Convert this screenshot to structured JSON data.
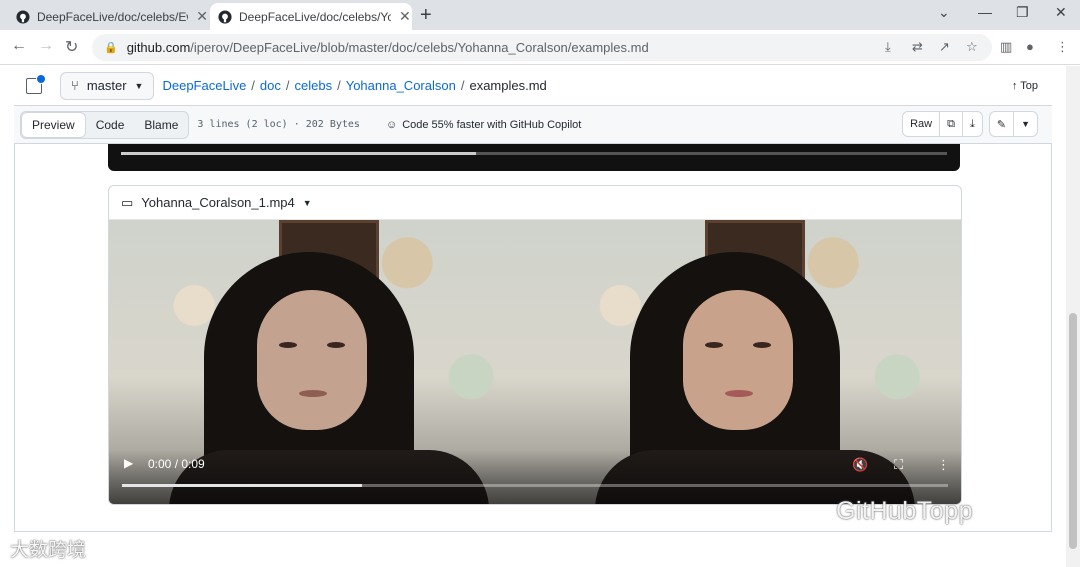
{
  "browser": {
    "tabs": [
      {
        "title": "DeepFaceLive/doc/celebs/Ewon_Spice/examples.md"
      },
      {
        "title": "DeepFaceLive/doc/celebs/Yohanna_Coralson/examples.md"
      }
    ],
    "url_host": "github.com",
    "url_path": "/iperov/DeepFaceLive/blob/master/doc/celebs/Yohanna_Coralson/examples.md"
  },
  "file": {
    "branch": "master",
    "breadcrumbs": [
      "DeepFaceLive",
      "doc",
      "celebs",
      "Yohanna_Coralson"
    ],
    "separator": "/",
    "filename": "examples.md",
    "top_label": "Top"
  },
  "toolbar": {
    "preview": "Preview",
    "code": "Code",
    "blame": "Blame",
    "meta": "3 lines (2 loc) · 202 Bytes",
    "copilot": "Code 55% faster with GitHub Copilot",
    "raw": "Raw"
  },
  "video": {
    "filename": "Yohanna_Coralson_1.mp4",
    "time": "0:00 / 0:09",
    "progress": 0.29,
    "prev_progress": 0.43
  },
  "watermarks": {
    "right": "GitHubTopp",
    "left": "大数跨境"
  }
}
